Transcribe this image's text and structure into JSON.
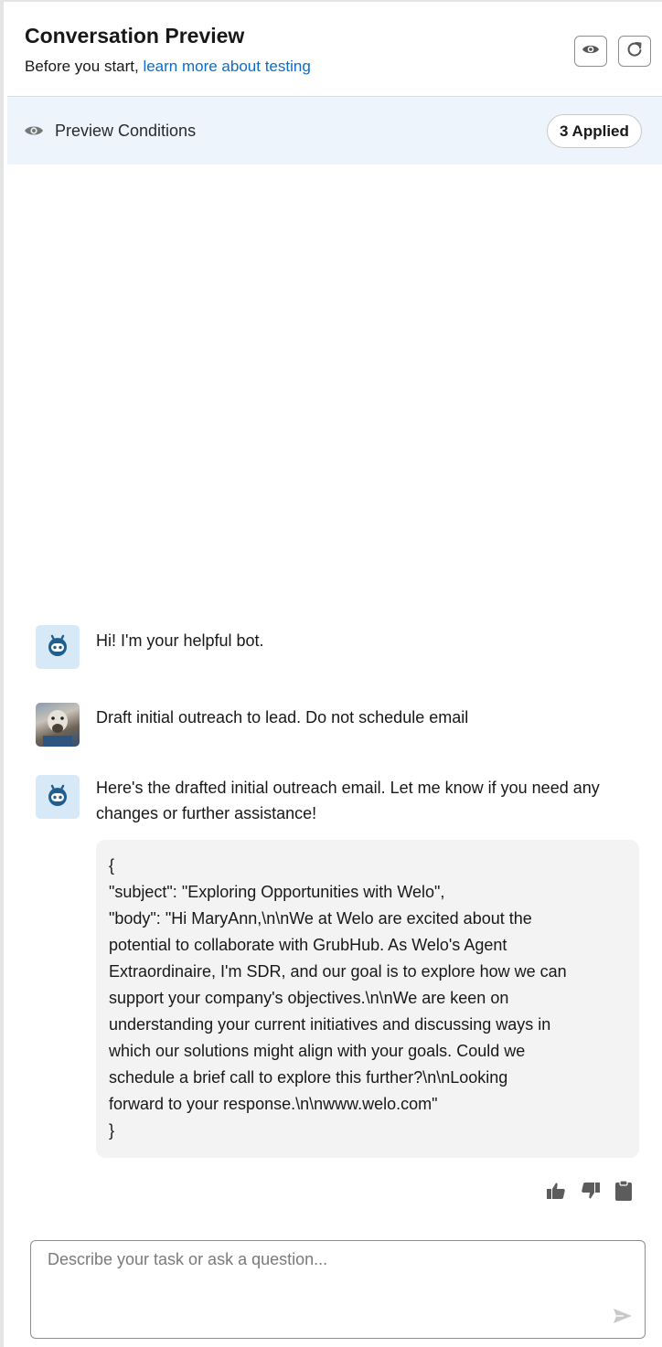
{
  "header": {
    "title": "Conversation Preview",
    "subtitle_prefix": "Before you start, ",
    "subtitle_link": "learn more about testing"
  },
  "conditions": {
    "label": "Preview Conditions",
    "badge": "3 Applied"
  },
  "messages": [
    {
      "sender": "bot",
      "text": "Hi! I'm your helpful bot."
    },
    {
      "sender": "user",
      "text": "Draft initial outreach to lead. Do not schedule email"
    },
    {
      "sender": "bot",
      "text": "Here's the drafted initial outreach email. Let me know if you need any changes or further assistance!",
      "code_lines": [
        "{",
        "\"subject\": \"Exploring Opportunities with Welo\",",
        "\"body\": \"Hi MaryAnn,\\n\\nWe at Welo are excited about the",
        "potential to collaborate with GrubHub. As Welo's Agent",
        "Extraordinaire, I'm SDR, and our goal is to explore how we can",
        "support your company's objectives.\\n\\nWe are keen on",
        "understanding your current initiatives and discussing ways in",
        "which our solutions might align with your goals. Could we",
        "schedule a brief call to explore this further?\\n\\nLooking",
        "forward to your response.\\n\\nwww.welo.com\"",
        "}"
      ]
    }
  ],
  "composer": {
    "placeholder": "Describe your task or ask a question...",
    "value": ""
  },
  "icons": {
    "eye": "eye-icon",
    "refresh": "refresh-icon",
    "bot": "bot-icon",
    "thumbs_up": "thumbs-up-icon",
    "thumbs_down": "thumbs-down-icon",
    "copy": "clipboard-icon",
    "send": "send-icon"
  },
  "colors": {
    "link": "#0b6dc7",
    "conditions_bg": "#eef4fc",
    "bot_avatar_bg": "#d7e8f7",
    "bot_icon": "#1e5f8f",
    "code_bg": "#f3f3f3"
  }
}
